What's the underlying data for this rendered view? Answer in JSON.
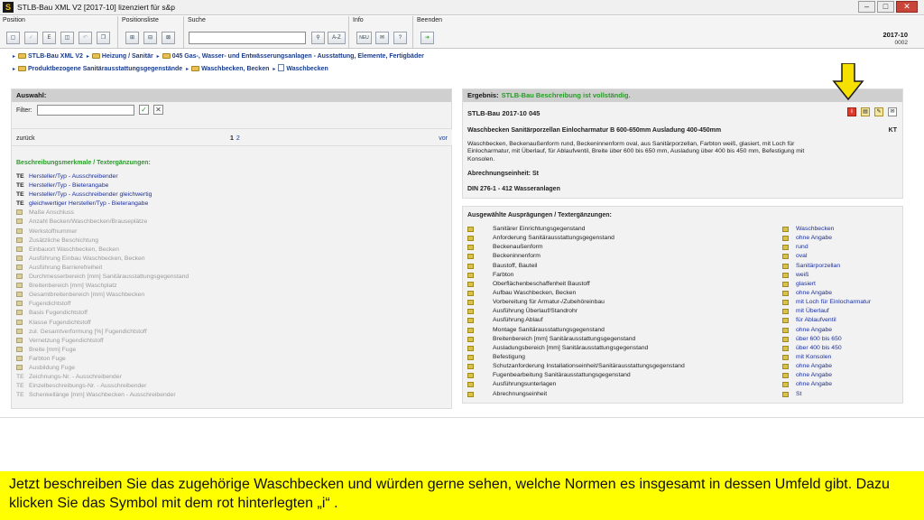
{
  "window": {
    "app_icon": "S",
    "title": "STLB-Bau XML V2 [2017-10] lizenziert für s&p",
    "controls": [
      "–",
      "□",
      "✕"
    ]
  },
  "toolbar": {
    "groups": {
      "position": "Position",
      "positionsliste": "Positionsliste",
      "suche": "Suche",
      "info": "Info",
      "beenden": "Beenden"
    },
    "search_value": "",
    "search_button": "A-Z",
    "new_button": "NEU",
    "help_button": "?",
    "version_main": "2017-10",
    "version_sub": "0002"
  },
  "breadcrumb": {
    "line1": [
      "STLB-Bau XML V2",
      "Heizung / Sanitär",
      "045 Gas-, Wasser- und Entwässerungsanlagen - Ausstattung, Elemente, Fertigbäder"
    ],
    "line2": [
      "Produktbezogene Sanitärausstattungsgegenstände",
      "Waschbecken, Becken",
      "Waschbecken"
    ]
  },
  "left_panel": {
    "header": "Auswahl:",
    "filter_label": "Filter:",
    "filter_value": "",
    "nav_back": "zurück",
    "page_current": "1",
    "page_next": "2",
    "nav_forward": "vor",
    "section_title": "Beschreibungsmerkmale / Textergänzungen:",
    "items": [
      {
        "tag": "TE",
        "text": "Hersteller/Typ - Ausschreibender",
        "active": true
      },
      {
        "tag": "TE",
        "text": "Hersteller/Typ - Bieterangabe",
        "active": true
      },
      {
        "tag": "TE",
        "text": "Hersteller/Typ - Ausschreibender gleichwertig",
        "active": true
      },
      {
        "tag": "TE",
        "text": "gleichwertiger Hersteller/Typ - Bieterangabe",
        "active": true
      },
      {
        "tag": "",
        "text": "Maße Anschluss",
        "active": false
      },
      {
        "tag": "",
        "text": "Anzahl Becken/Waschbecken/Brauseplätze",
        "active": false
      },
      {
        "tag": "",
        "text": "Werkstoffnummer",
        "active": false
      },
      {
        "tag": "",
        "text": "Zusätzliche Beschichtung",
        "active": false
      },
      {
        "tag": "",
        "text": "Einbauort Waschbecken, Becken",
        "active": false
      },
      {
        "tag": "",
        "text": "Ausführung Einbau Waschbecken, Becken",
        "active": false
      },
      {
        "tag": "",
        "text": "Ausführung Barrierefreiheit",
        "active": false
      },
      {
        "tag": "",
        "text": "Durchmesserbereich [mm] Sanitärausstattungsgegenstand",
        "active": false
      },
      {
        "tag": "",
        "text": "Breitenbereich [mm] Waschplatz",
        "active": false
      },
      {
        "tag": "",
        "text": "Gesamtbreitenbereich [mm] Waschbecken",
        "active": false
      },
      {
        "tag": "",
        "text": "Fugendichtstoff",
        "active": false
      },
      {
        "tag": "",
        "text": "Basis Fugendichtstoff",
        "active": false
      },
      {
        "tag": "",
        "text": "Klasse Fugendichtstoff",
        "active": false
      },
      {
        "tag": "",
        "text": "zul. Gesamtverformung [%] Fugendichtstoff",
        "active": false
      },
      {
        "tag": "",
        "text": "Vernetzung Fugendichtstoff",
        "active": false
      },
      {
        "tag": "",
        "text": "Breite [mm] Fuge",
        "active": false
      },
      {
        "tag": "",
        "text": "Farbton Fuge",
        "active": false
      },
      {
        "tag": "",
        "text": "Ausbildung Fuge",
        "active": false
      },
      {
        "tag": "TE",
        "text": "Zeichnungs-Nr. - Ausschreibender",
        "active": false
      },
      {
        "tag": "TE",
        "text": "Einzelbeschreibungs-Nr. - Ausschreibender",
        "active": false
      },
      {
        "tag": "TE",
        "text": "Schenkellänge [mm] Waschbecken - Ausschreibender",
        "active": false
      }
    ]
  },
  "result_panel": {
    "header_label": "Ergebnis:",
    "header_status": "STLB-Bau Beschreibung ist vollständig.",
    "title": "STLB-Bau 2017-10 045",
    "icons": [
      "info-icon",
      "note-icon",
      "edit-icon",
      "mail-icon"
    ],
    "icon_info_glyph": "i",
    "heading": "Waschbecken Sanitärporzellan Einlocharmatur B 600-650mm Ausladung 400-450mm",
    "unit": "KT",
    "description": "Waschbecken, Beckenaußenform rund, Beckeninnenform oval, aus Sanitärporzellan, Farbton weiß, glasiert, mit Loch für Einlocharmatur, mit Überlauf, für Ablaufventil, Breite über 600 bis 650 mm, Ausladung über 400 bis 450 mm, Befestigung mit Konsolen.",
    "abrechnung": "Abrechnungseinheit: St",
    "din": "DIN 276-1 - 412 Wasseranlagen"
  },
  "specs_panel": {
    "header": "Ausgewählte Ausprägungen / Textergänzungen:",
    "rows": [
      {
        "name": "Sanitärer Einrichtungsgegenstand",
        "value": "Waschbecken"
      },
      {
        "name": "Anforderung Sanitärausstattungsgegenstand",
        "value": "ohne Angabe"
      },
      {
        "name": "Beckenaußenform",
        "value": "rund"
      },
      {
        "name": "Beckeninnenform",
        "value": "oval"
      },
      {
        "name": "Baustoff, Bauteil",
        "value": "Sanitärporzellan"
      },
      {
        "name": "Farbton",
        "value": "weiß"
      },
      {
        "name": "Oberflächenbeschaffenheit Baustoff",
        "value": "glasiert"
      },
      {
        "name": "Aufbau Waschbecken, Becken",
        "value": "ohne Angabe"
      },
      {
        "name": "Vorbereitung für Armatur-/Zubehöreinbau",
        "value": "mit Loch für Einlocharmatur"
      },
      {
        "name": "Ausführung Überlauf/Standrohr",
        "value": "mit Überlauf"
      },
      {
        "name": "Ausführung Ablauf",
        "value": "für Ablaufventil"
      },
      {
        "name": "Montage Sanitärausstattungsgegenstand",
        "value": "ohne Angabe"
      },
      {
        "name": "Breitenbereich [mm] Sanitärausstattungsgegenstand",
        "value": "über 600 bis 650"
      },
      {
        "name": "Ausladungsbereich [mm] Sanitärausstattungsgegenstand",
        "value": "über 400 bis 450"
      },
      {
        "name": "Befestigung",
        "value": "mit Konsolen"
      },
      {
        "name": "Schutzanforderung Installationseinheit/Sanitärausstattungsgegenstand",
        "value": "ohne Angabe"
      },
      {
        "name": "Fugenbearbeitung Sanitärausstattungsgegenstand",
        "value": "ohne Angabe"
      },
      {
        "name": "Ausführungsunterlagen",
        "value": "ohne Angabe"
      },
      {
        "name": "Abrechnungseinheit",
        "value": "St"
      }
    ]
  },
  "caption": "Jetzt beschreiben Sie das zugehörige Waschbecken und würden gerne sehen, welche Normen es insgesamt in dessen Umfeld gibt. Dazu klicken Sie das Symbol mit dem rot hinterlegten „i“ .",
  "colors": {
    "accent_green": "#2a9a2a",
    "link_blue": "#1b2f9a",
    "caption_bg": "#ffff00",
    "arrow": "#f5e000"
  }
}
